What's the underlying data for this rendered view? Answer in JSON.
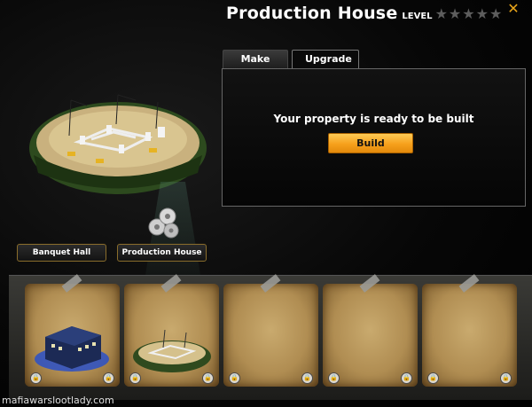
{
  "header": {
    "title": "Production House",
    "level_label": "LEVEL",
    "stars_total": 5,
    "stars_filled": 0,
    "star_glyph": "★",
    "close_glyph": "✕"
  },
  "tabs": [
    {
      "label": "Make",
      "active": false
    },
    {
      "label": "Upgrade",
      "active": true
    }
  ],
  "panel": {
    "status_text": "Your property is ready to be built",
    "build_label": "Build"
  },
  "properties": {
    "buttons": [
      {
        "label": "Banquet Hall"
      },
      {
        "label": "Production House"
      }
    ]
  },
  "cards": [
    {
      "name": "banquet-hall",
      "thumb": "building"
    },
    {
      "name": "production-house",
      "thumb": "construction-site"
    },
    {
      "name": "empty-slot",
      "thumb": ""
    },
    {
      "name": "empty-slot",
      "thumb": ""
    },
    {
      "name": "empty-slot",
      "thumb": ""
    }
  ],
  "lock_glyph": "🔒",
  "watermark": "mafiawarslootlady.com",
  "colors": {
    "accent_orange": "#f6a01c",
    "star_gray": "#5d5d5d",
    "close_orange": "#e8a51a"
  }
}
